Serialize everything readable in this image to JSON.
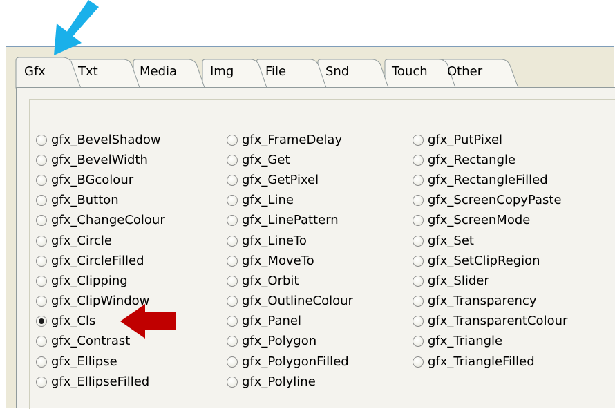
{
  "tabs": [
    {
      "label": "Gfx",
      "selected": true
    },
    {
      "label": "Txt"
    },
    {
      "label": "Media"
    },
    {
      "label": "Img"
    },
    {
      "label": "File"
    },
    {
      "label": "Snd"
    },
    {
      "label": "Touch"
    },
    {
      "label": "Other"
    }
  ],
  "columns": [
    [
      "gfx_BevelShadow",
      "gfx_BevelWidth",
      "gfx_BGcolour",
      "gfx_Button",
      "gfx_ChangeColour",
      "gfx_Circle",
      "gfx_CircleFilled",
      "gfx_Clipping",
      "gfx_ClipWindow",
      "gfx_Cls",
      "gfx_Contrast",
      "gfx_Ellipse",
      "gfx_EllipseFilled"
    ],
    [
      "gfx_FrameDelay",
      "gfx_Get",
      "gfx_GetPixel",
      "gfx_Line",
      "gfx_LinePattern",
      "gfx_LineTo",
      "gfx_MoveTo",
      "gfx_Orbit",
      "gfx_OutlineColour",
      "gfx_Panel",
      "gfx_Polygon",
      "gfx_PolygonFilled",
      "gfx_Polyline"
    ],
    [
      "gfx_PutPixel",
      "gfx_Rectangle",
      "gfx_RectangleFilled",
      "gfx_ScreenCopyPaste",
      "gfx_ScreenMode",
      "gfx_Set",
      "gfx_SetClipRegion",
      "gfx_Slider",
      "gfx_Transparency",
      "gfx_TransparentColour",
      "gfx_Triangle",
      "gfx_TriangleFilled"
    ]
  ],
  "selected_option": "gfx_Cls",
  "annotations": {
    "blue_arrow_color": "#1ab0ea",
    "red_arrow_color": "#c00000"
  }
}
